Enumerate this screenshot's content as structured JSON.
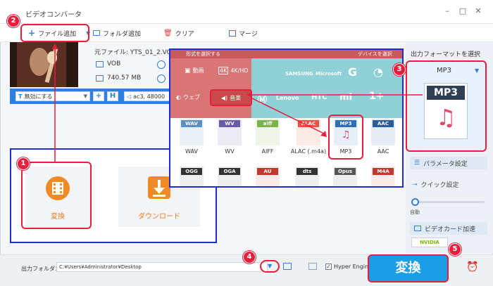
{
  "window": {
    "title": "ビデオコンバータ"
  },
  "toolbar": {
    "add_file": "ファイル追加",
    "add_folder": "フォルダ追加",
    "clear": "クリア",
    "merge": "マージ"
  },
  "file": {
    "source_name": "元ファイル: YTS_01_2.VOB",
    "container": "VOB",
    "size": "740.57 MB",
    "subtitle": "無効にする",
    "audio": "ac3, 48000"
  },
  "actions": {
    "convert": "変換",
    "download": "ダウンロード"
  },
  "popup": {
    "header_left": "形式を選択する",
    "header_right": "デバイスを選択",
    "categories": {
      "video": "動画",
      "video_4k": "4K/HD",
      "web": "ウェブ",
      "music": "音楽"
    },
    "brands": [
      "SAMSUNG",
      "Microsoft",
      "Lenovo",
      "HTC"
    ],
    "formats_row1": [
      {
        "tag": "WAV",
        "label": "WAV",
        "color": "#5b8fc8"
      },
      {
        "tag": "WV",
        "label": "WV",
        "color": "#6a5aa8"
      },
      {
        "tag": "aiff",
        "label": "AIFF",
        "color": "#7bb44a"
      },
      {
        "tag": "ALAC",
        "label": "ALAC (.m4a)",
        "color": "#e4553f"
      },
      {
        "tag": "MP3",
        "label": "MP3",
        "color": "#2f6fb7"
      },
      {
        "tag": "AAC",
        "label": "AAC",
        "color": "#2b5c9e"
      }
    ],
    "formats_row2": [
      {
        "tag": "OGG",
        "color": "#333333"
      },
      {
        "tag": "OGA",
        "color": "#333333"
      },
      {
        "tag": "AU",
        "color": "#c0392b"
      },
      {
        "tag": "dts",
        "color": "#333333"
      },
      {
        "tag": "Opus",
        "color": "#555555"
      },
      {
        "tag": "M4A",
        "color": "#c0392b"
      }
    ]
  },
  "right_panel": {
    "title": "出力フォーマットを選択",
    "selected": "MP3",
    "big_tag": "MP3",
    "param": "パラメータ設定",
    "quick": "クイック設定",
    "auto": "自動",
    "gpu": "ビデオカード加速",
    "nvidia": "NVIDIA"
  },
  "bottom": {
    "output_label": "出力フォルダ：",
    "output_path": "C:¥Users¥Administrator¥Desktop",
    "hyper": "Hyper Engine",
    "convert": "変換"
  },
  "annotations": [
    "1",
    "2",
    "3",
    "4",
    "5"
  ],
  "colors": {
    "accent": "#2f7fe0",
    "highlight": "#e81e3c",
    "convert": "#1b9ee8",
    "orange": "#e67e22"
  }
}
